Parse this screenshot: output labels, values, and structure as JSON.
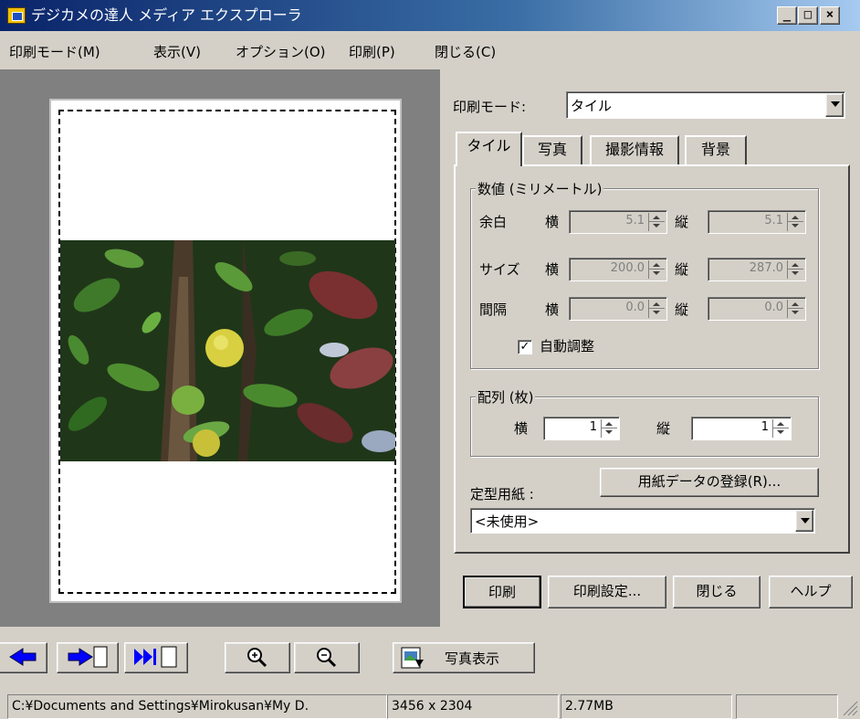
{
  "window": {
    "title": "デジカメの達人 メディア エクスプローラ",
    "minimize_glyph": "_",
    "maximize_glyph": "□",
    "close_glyph": "×"
  },
  "menu": [
    {
      "label": "印刷モード(M)"
    },
    {
      "label": "表示(V)"
    },
    {
      "label": "オプション(O)"
    },
    {
      "label": "印刷(P)"
    },
    {
      "label": "閉じる(C)"
    }
  ],
  "print_mode": {
    "label": "印刷モード:",
    "value": "タイル"
  },
  "tabs": [
    {
      "label": "タイル",
      "active": true
    },
    {
      "label": "写真",
      "active": false
    },
    {
      "label": "撮影情報",
      "active": false
    },
    {
      "label": "背景",
      "active": false
    }
  ],
  "numeric_group": {
    "title": "数値 (ミリメートル)",
    "horizontal_label": "横",
    "vertical_label": "縦",
    "rows": [
      {
        "label": "余白",
        "h": "5.1",
        "v": "5.1"
      },
      {
        "label": "サイズ",
        "h": "200.0",
        "v": "287.0"
      },
      {
        "label": "間隔",
        "h": "0.0",
        "v": "0.0"
      }
    ],
    "auto_adjust": {
      "label": "自動調整",
      "checked": true,
      "check_glyph": "✓"
    }
  },
  "layout_group": {
    "title": "配列 (枚)",
    "horizontal_label": "横",
    "vertical_label": "縦",
    "h": "1",
    "v": "1"
  },
  "paper": {
    "label": "定型用紙 :",
    "register_button": "用紙データの登録(R)...",
    "value": "<未使用>"
  },
  "actions": {
    "print": "印刷",
    "print_settings": "印刷設定...",
    "close": "閉じる",
    "help": "ヘルプ"
  },
  "nav": {
    "photo_view_label": "写真表示",
    "icons": [
      "prev-arrow-icon",
      "next-page-icon",
      "last-page-icon",
      "zoom-in-icon",
      "zoom-out-icon",
      "photo-view-icon"
    ]
  },
  "status": {
    "path": "C:¥Documents and Settings¥Mirokusan¥My D.",
    "dimensions": "3456 x 2304",
    "size": "2.77MB",
    "extra": ""
  },
  "colors": {
    "titlebar_start": "#0a246a",
    "titlebar_end": "#a6caf0",
    "face": "#d4d0c8",
    "preview_bg": "#808080",
    "nav_blue": "#0000ff"
  }
}
